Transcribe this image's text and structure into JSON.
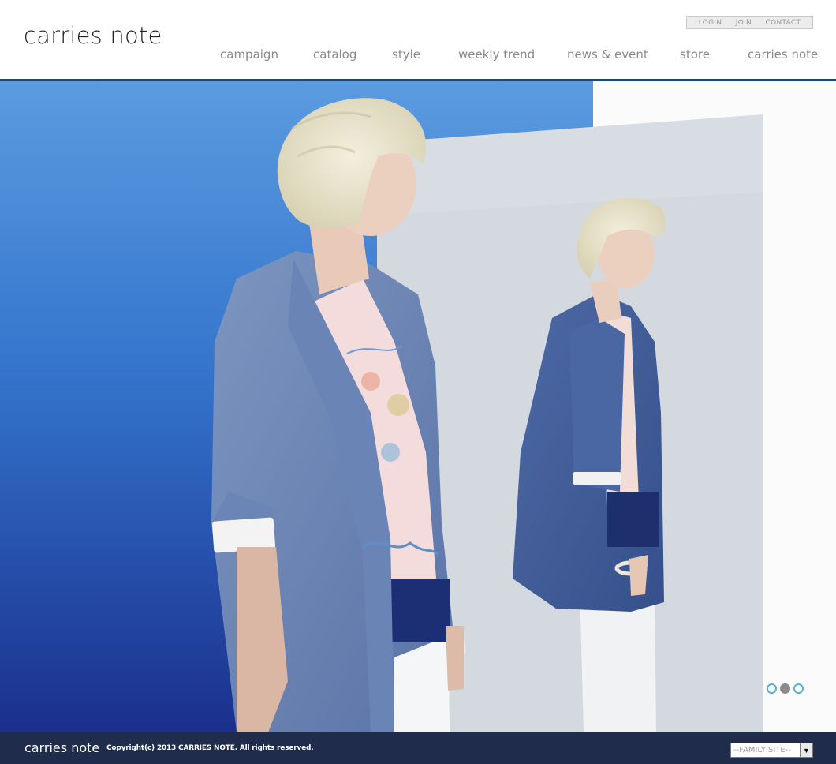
{
  "header": {
    "logo": "carries note",
    "util_links": [
      "LOGIN",
      "JOIN",
      "CONTACT"
    ],
    "nav": [
      "campaign",
      "catalog",
      "style",
      "weekly trend",
      "news & event",
      "store",
      "carries note"
    ]
  },
  "hero": {
    "slide_count": 3,
    "active_slide": 2
  },
  "footer": {
    "logo": "carries note",
    "copyright": "Copyright(c) 2013 CARRIES NOTE. All rights reserved.",
    "family_site": "--FAMILY SITE--"
  },
  "colors": {
    "header_rule": "#1f4773",
    "footer_bg": "#1f2c4b",
    "dot_accent": "#53b3d1",
    "backdrop_blue": "#3f7fcf"
  }
}
